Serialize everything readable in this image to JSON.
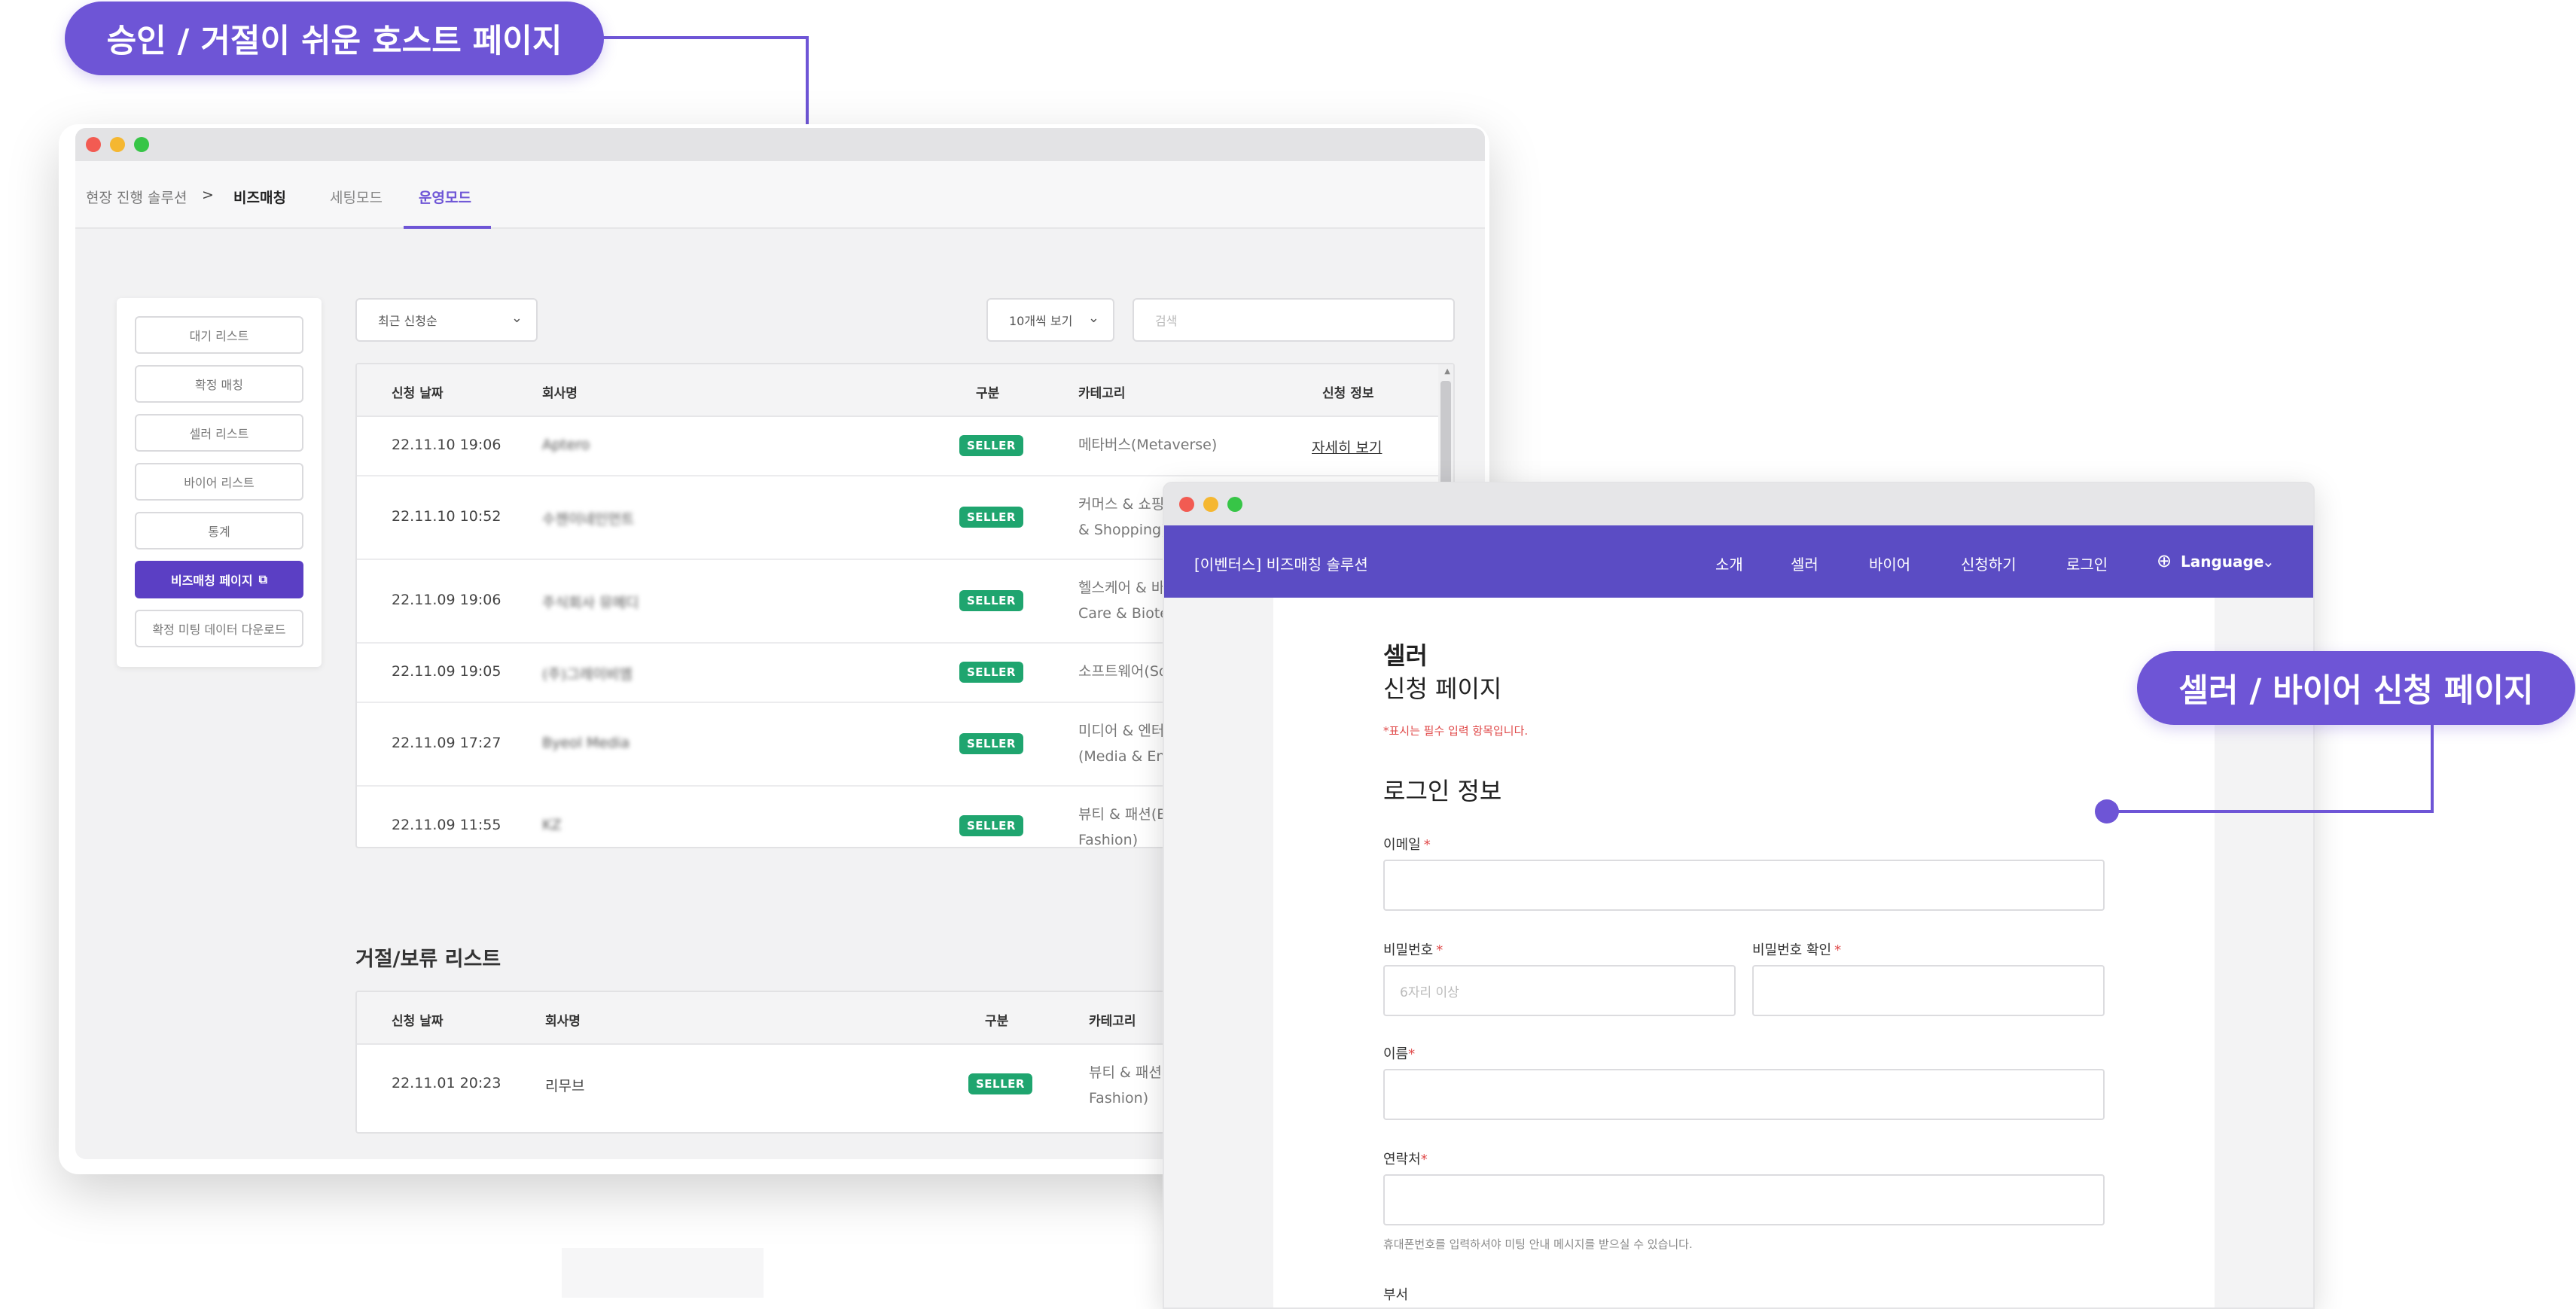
{
  "callouts": {
    "left": "승인 / 거절이 쉬운 호스트 페이지",
    "right": "셀러 / 바이어 신청 페이지"
  },
  "host": {
    "breadcrumb": [
      "현장 진행 솔루션",
      ">",
      "비즈매칭"
    ],
    "tabs": [
      "세팅모드",
      "운영모드"
    ],
    "active_tab": "운영모드",
    "sidebar": [
      "대기 리스트",
      "확정 매칭",
      "셀러 리스트",
      "바이어 리스트",
      "통계",
      "비즈매칭 페이지",
      "확정 미팅 데이터 다운로드"
    ],
    "sort_select": "최근 신청순",
    "page_size_select": "10개씩 보기",
    "search_placeholder": "검색",
    "main_table": {
      "headers": [
        "신청 날짜",
        "회사명",
        "구분",
        "카테고리",
        "신청 정보"
      ],
      "rows": [
        {
          "date": "22.11.10 19:06",
          "company": "Aptero",
          "type": "SELLER",
          "category": [
            "메타버스(Metaverse)"
          ],
          "info": "자세히 보기"
        },
        {
          "date": "22.11.10 10:52",
          "company": "수젠이네인먼트",
          "type": "SELLER",
          "category": [
            "커머스 & 쇼핑(",
            "& Shopping)"
          ],
          "info": ""
        },
        {
          "date": "22.11.09 19:06",
          "company": "주식회사 뮤메디",
          "type": "SELLER",
          "category": [
            "헬스케어 & 바이",
            "Care & Biotec"
          ],
          "info": ""
        },
        {
          "date": "22.11.09 19:05",
          "company": "(주)그레이비엠",
          "type": "SELLER",
          "category": [
            "소프트웨어(So"
          ],
          "info": ""
        },
        {
          "date": "22.11.09 17:27",
          "company": "Byeol Media",
          "type": "SELLER",
          "category": [
            "미디어 & 엔터",
            "(Media & Ent"
          ],
          "info": ""
        },
        {
          "date": "22.11.09 11:55",
          "company": "KZ",
          "type": "SELLER",
          "category": [
            "뷰티 & 패션(B",
            "Fashion)"
          ],
          "info": ""
        }
      ]
    },
    "reject_section_title": "거절/보류 리스트",
    "reject_table": {
      "headers": [
        "신청 날짜",
        "회사명",
        "구분",
        "카테고리"
      ],
      "rows": [
        {
          "date": "22.11.01 20:23",
          "company": "리무브",
          "type": "SELLER",
          "category": [
            "뷰티 & 패션(",
            "Fashion)"
          ]
        }
      ]
    }
  },
  "seller": {
    "brand": "[이벤터스] 비즈매칭 솔루션",
    "menu": [
      "소개",
      "셀러",
      "바이어",
      "신청하기",
      "로그인"
    ],
    "language": "Language",
    "title_1": "셀러",
    "title_2": "신청 페이지",
    "required_note": "*표시는 필수 입력 항목입니다.",
    "section_title": "로그인 정보",
    "fields": {
      "email": "이메일",
      "password": "비밀번호",
      "password_placeholder": "6자리 이상",
      "password_confirm": "비밀번호 확인",
      "name": "이름",
      "phone": "연락처",
      "phone_hint": "휴대폰번호를 입력하셔야 미팅 안내 메시지를 받으실 수 있습니다.",
      "department": "부서"
    },
    "required_mark": "*"
  },
  "colors": {
    "accent": "#6E55D6",
    "nav_bg": "#5b4cc4",
    "badge": "#1fa56f",
    "required": "#e04a4a"
  }
}
